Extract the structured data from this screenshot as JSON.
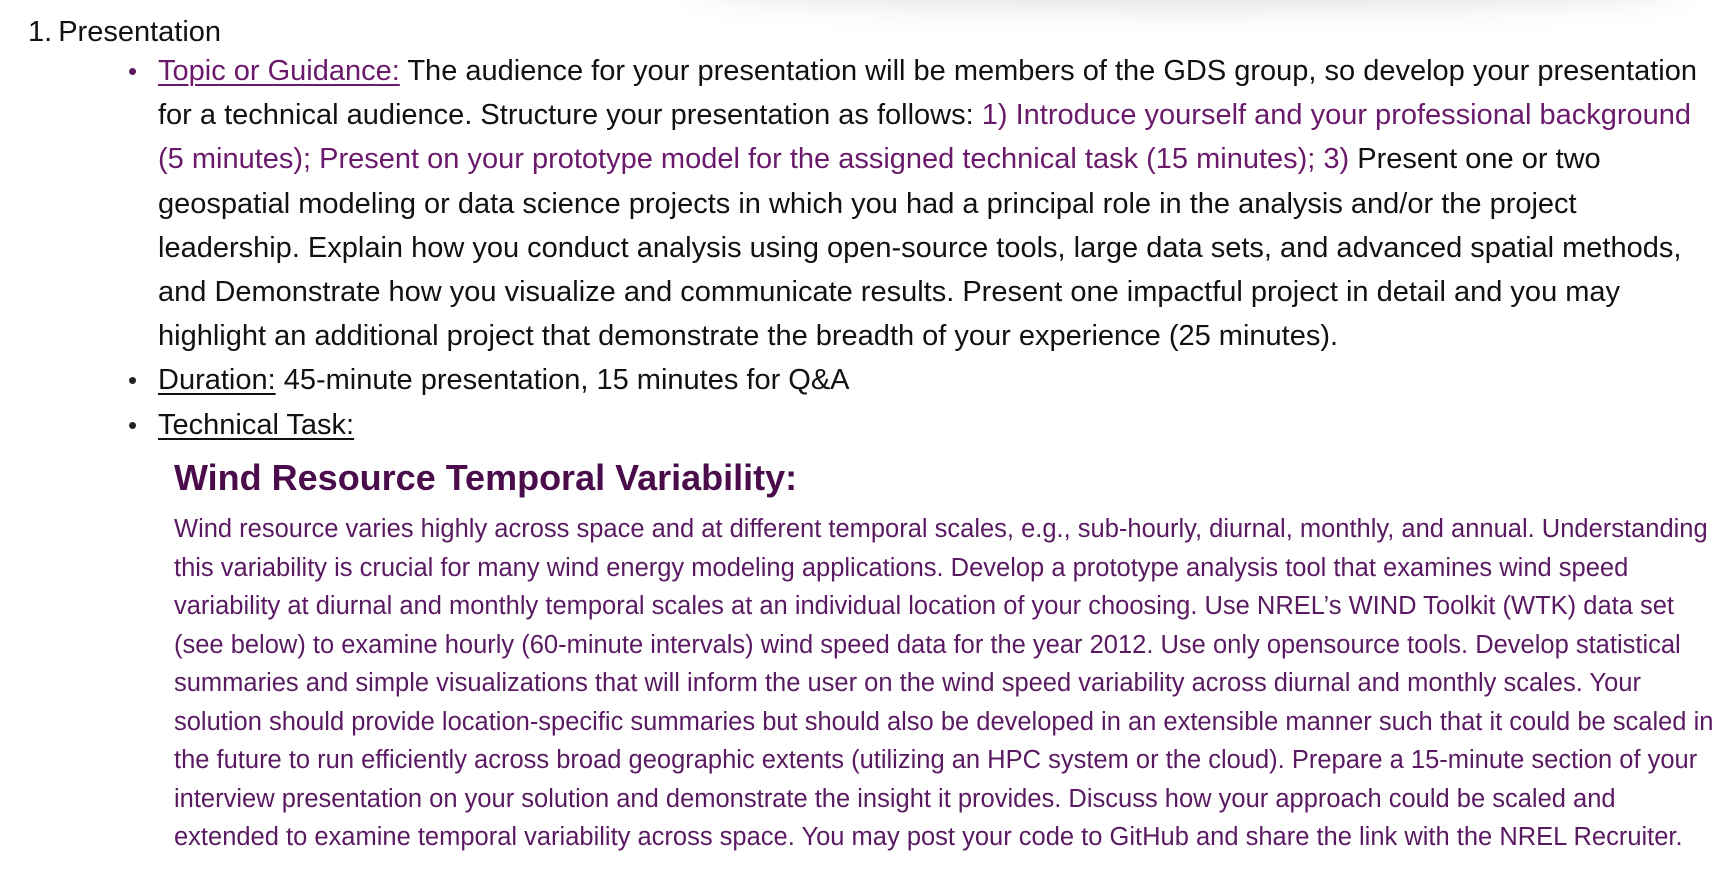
{
  "section": {
    "number": "1.",
    "title": "Presentation"
  },
  "bullets": {
    "topic": {
      "label": "Topic or Guidance:",
      "text_intro": " The audience for your presentation will be members of the GDS group, so develop your presentation for a technical audience. Structure your presentation as follows: ",
      "text_purple": "1) Introduce yourself and your professional background (5 minutes); Present on your prototype model for the assigned technical task (15 minutes); 3)",
      "text_rest": " Present one or two geospatial modeling or data science projects in which you had a principal role in the analysis and/or the project leadership. Explain how you conduct analysis using open-source tools, large data sets, and advanced spatial methods, and Demonstrate how you visualize and communicate results. Present one impactful project in detail and you may highlight an additional project that demonstrate the breadth of your experience (25 minutes)."
    },
    "duration": {
      "label": "Duration:",
      "text": " 45-minute presentation, 15 minutes for Q&A"
    },
    "technical_task": {
      "label": "Technical Task:"
    }
  },
  "task": {
    "heading": "Wind Resource Temporal Variability:",
    "body": "Wind resource varies highly across space and at different temporal scales, e.g., sub-hourly, diurnal, monthly, and annual. Understanding this variability is crucial for many wind energy modeling applications. Develop a prototype analysis tool that examines wind speed variability at diurnal and monthly temporal scales at an individual location of your choosing. Use NREL’s WIND Toolkit (WTK) data set (see below) to examine hourly (60-minute intervals) wind speed data for the year 2012. Use only opensource tools. Develop statistical summaries and simple visualizations that will inform the user on the wind speed variability across diurnal and monthly scales. Your solution should provide location-specific summaries but should also be developed in an extensible manner such that it could be scaled in the future to run efficiently across broad geographic extents (utilizing an HPC system or the cloud). Prepare a 15-minute section of your interview presentation on your solution and demonstrate the insight it provides. Discuss how your approach could be scaled and extended to examine temporal variability across space. You may post your code to GitHub and share the link with the NREL Recruiter."
  },
  "icons": {
    "bullet_marker": "bullet-dot-icon"
  },
  "colors": {
    "text": "#111111",
    "accent_purple": "#6b1a6b",
    "heading_purple": "#4a0c4a"
  }
}
